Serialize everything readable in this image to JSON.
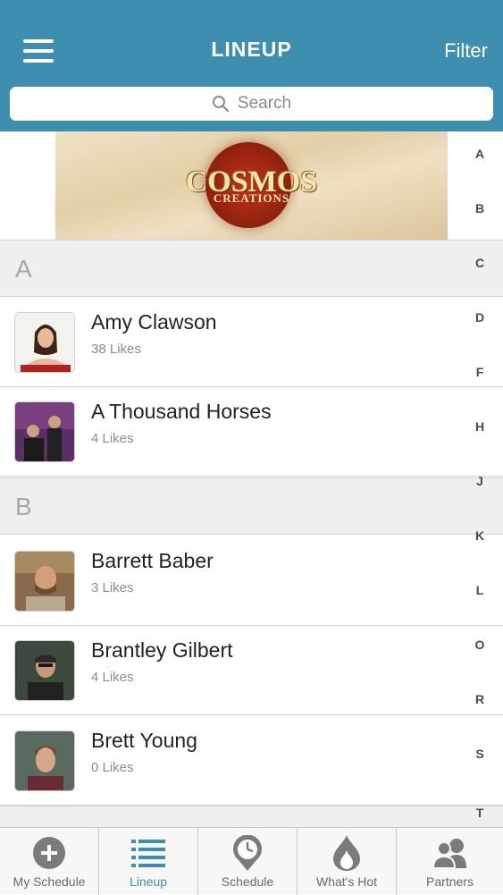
{
  "header": {
    "title": "LINEUP",
    "filter_label": "Filter",
    "menu_icon": "hamburger-menu-icon"
  },
  "search": {
    "placeholder": "Search"
  },
  "banner": {
    "line1": "COSMOS",
    "line2": "CREATIONS"
  },
  "sections": [
    {
      "letter": "A",
      "artists": [
        {
          "name": "Amy Clawson",
          "likes": "38 Likes"
        },
        {
          "name": "A Thousand Horses",
          "likes": "4 Likes"
        }
      ]
    },
    {
      "letter": "B",
      "artists": [
        {
          "name": "Barrett Baber",
          "likes": "3 Likes"
        },
        {
          "name": "Brantley Gilbert",
          "likes": "4 Likes"
        },
        {
          "name": "Brett Young",
          "likes": "0 Likes"
        }
      ]
    }
  ],
  "index_letters": [
    "A",
    "B",
    "C",
    "D",
    "F",
    "H",
    "J",
    "K",
    "L",
    "O",
    "R",
    "S",
    "T"
  ],
  "tabs": [
    {
      "label": "My Schedule",
      "icon": "add-circle-icon",
      "active": false
    },
    {
      "label": "Lineup",
      "icon": "list-icon",
      "active": true
    },
    {
      "label": "Schedule",
      "icon": "clock-pin-icon",
      "active": false
    },
    {
      "label": "What's Hot",
      "icon": "flame-icon",
      "active": false
    },
    {
      "label": "Partners",
      "icon": "people-icon",
      "active": false
    }
  ],
  "colors": {
    "header": "#3e8faf",
    "accent": "#3e8faf",
    "section_bg": "#efeff0"
  }
}
